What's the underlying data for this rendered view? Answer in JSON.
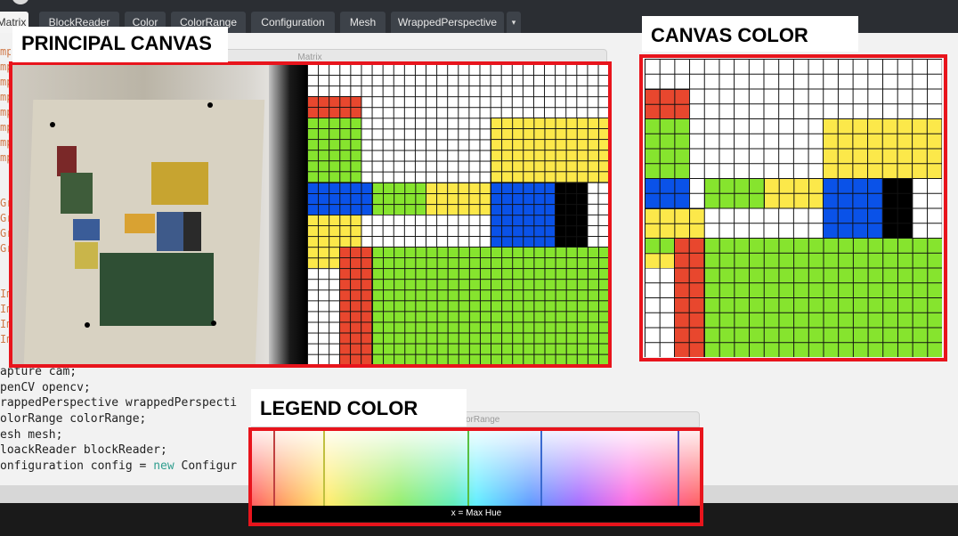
{
  "tabs": [
    {
      "label": "Matrix",
      "active": true
    },
    {
      "label": "BlockReader"
    },
    {
      "label": "Color"
    },
    {
      "label": "ColorRange"
    },
    {
      "label": "Configuration"
    },
    {
      "label": "Mesh"
    },
    {
      "label": "WrappedPerspective"
    }
  ],
  "tab_more_icon": "▾",
  "code_lines": [
    {
      "pre": "apture cam;"
    },
    {
      "pre": "penCV opencv;"
    },
    {
      "pre": "rappedPerspective wrappedPerspecti"
    },
    {
      "pre": "olorRange colorRange;"
    },
    {
      "pre": "esh mesh;"
    },
    {
      "pre": "loackReader blockReader;"
    },
    {
      "pre": "onfiguration config = ",
      "kw": "new",
      "post": " Configur"
    }
  ],
  "gutter_chars": [
    "mp",
    "mp",
    "mp",
    "mp",
    "mp",
    "mp",
    "mp",
    "mp",
    "",
    "",
    "Gr",
    "Gr",
    "Gr",
    "Gr",
    "",
    "",
    "Im",
    "Im",
    "Im",
    "Im",
    "Lo"
  ],
  "windows": {
    "matrix_title": "Matrix",
    "colorrange_title": "orRange"
  },
  "labels": {
    "principal_canvas": "PRINCIPAL CANVAS",
    "canvas_color": "CANVAS COLOR",
    "legend_color": "LEGEND COLOR"
  },
  "legend": {
    "caption": "x = Max Hue"
  },
  "colors": {
    "frame_red": "#e8141c",
    "cell_red": "#e8472e",
    "cell_green": "#86e42e",
    "cell_yellow": "#fce84a",
    "cell_blue": "#0a52e8",
    "cell_black": "#000000",
    "tab_bar": "#2b2e33"
  },
  "canvas_color_grid": {
    "cols": 20,
    "rows": 20,
    "regions": [
      {
        "color": "cell_red",
        "c0": 0,
        "c1": 3,
        "r0": 2,
        "r1": 4
      },
      {
        "color": "cell_green",
        "c0": 0,
        "c1": 3,
        "r0": 4,
        "r1": 8
      },
      {
        "color": "cell_yellow",
        "c0": 12,
        "c1": 20,
        "r0": 4,
        "r1": 8
      },
      {
        "color": "cell_blue",
        "c0": 0,
        "c1": 3,
        "r0": 8,
        "r1": 10
      },
      {
        "color": "cell_green",
        "c0": 4,
        "c1": 8,
        "r0": 8,
        "r1": 10
      },
      {
        "color": "cell_yellow",
        "c0": 8,
        "c1": 12,
        "r0": 8,
        "r1": 10
      },
      {
        "color": "cell_blue",
        "c0": 12,
        "c1": 16,
        "r0": 8,
        "r1": 12
      },
      {
        "color": "cell_black",
        "c0": 16,
        "c1": 18,
        "r0": 8,
        "r1": 12
      },
      {
        "color": "cell_yellow",
        "c0": 0,
        "c1": 2,
        "r0": 10,
        "r1": 14
      },
      {
        "color": "cell_green",
        "c0": 0,
        "c1": 4,
        "r0": 12,
        "r1": 13
      },
      {
        "color": "cell_yellow",
        "c0": 0,
        "c1": 4,
        "r0": 10,
        "r1": 12
      },
      {
        "color": "cell_red",
        "c0": 2,
        "c1": 4,
        "r0": 12,
        "r1": 20
      },
      {
        "color": "cell_green",
        "c0": 4,
        "c1": 20,
        "r0": 12,
        "r1": 20
      }
    ]
  },
  "principal_grid": {
    "cols": 28,
    "rows": 28,
    "regions": [
      {
        "color": "cell_red",
        "c0": 0,
        "c1": 5,
        "r0": 3,
        "r1": 5
      },
      {
        "color": "cell_green",
        "c0": 0,
        "c1": 5,
        "r0": 5,
        "r1": 11
      },
      {
        "color": "cell_yellow",
        "c0": 17,
        "c1": 28,
        "r0": 5,
        "r1": 11
      },
      {
        "color": "cell_blue",
        "c0": 0,
        "c1": 6,
        "r0": 11,
        "r1": 14
      },
      {
        "color": "cell_green",
        "c0": 6,
        "c1": 11,
        "r0": 11,
        "r1": 14
      },
      {
        "color": "cell_yellow",
        "c0": 11,
        "c1": 17,
        "r0": 11,
        "r1": 14
      },
      {
        "color": "cell_blue",
        "c0": 17,
        "c1": 23,
        "r0": 11,
        "r1": 17
      },
      {
        "color": "cell_black",
        "c0": 23,
        "c1": 26,
        "r0": 11,
        "r1": 17
      },
      {
        "color": "cell_yellow",
        "c0": 0,
        "c1": 5,
        "r0": 14,
        "r1": 19
      },
      {
        "color": "cell_red",
        "c0": 3,
        "c1": 6,
        "r0": 17,
        "r1": 28
      },
      {
        "color": "cell_green",
        "c0": 6,
        "c1": 28,
        "r0": 17,
        "r1": 28
      }
    ]
  }
}
